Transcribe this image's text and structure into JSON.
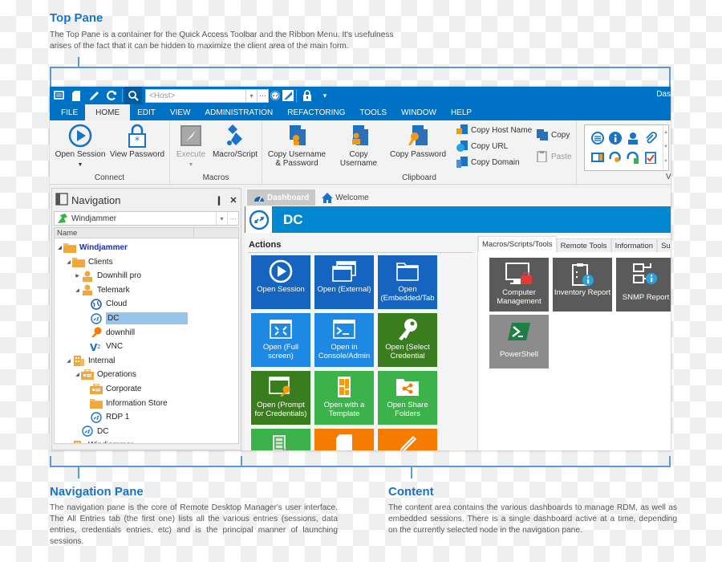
{
  "captions": {
    "top_pane": {
      "title": "Top Pane",
      "line1": "The Top Pane is a container for the Quick Access Toolbar and the Ribbon Menu. It's usefulness",
      "line2": "arises of the fact that it can be hidden to maximize the client area of the main form."
    },
    "navigation_pane": {
      "title": "Navigation Pane",
      "text": "The navigation pane is the core of Remote Desktop Manager's user interface. The All Entries tab (the first one) lists all the various entries (sessions, data entries, credentials entries, etc) and is the principal manner of launching sessions."
    },
    "content": {
      "title": "Content",
      "text": "The content area contains the various dashboards to manage RDM, as well as embedded sessions. There is a single dashboard active at a time, depending on the currently selected node in the navigation pane."
    }
  },
  "quick_access": {
    "icons": [
      "window-icon",
      "new-document-icon",
      "edit-pencil-icon",
      "refresh-icon",
      "search-icon"
    ],
    "host_placeholder": "<Host>",
    "more_label": "···",
    "title_fragment": "Das"
  },
  "menu_tabs": [
    {
      "label": "FILE",
      "active": false
    },
    {
      "label": "HOME",
      "active": true
    },
    {
      "label": "EDIT",
      "active": false
    },
    {
      "label": "VIEW",
      "active": false
    },
    {
      "label": "ADMINISTRATION",
      "active": false
    },
    {
      "label": "REFACTORING",
      "active": false
    },
    {
      "label": "TOOLS",
      "active": false
    },
    {
      "label": "WINDOW",
      "active": false
    },
    {
      "label": "HELP",
      "active": false
    }
  ],
  "ribbon": {
    "connect": {
      "label": "Connect",
      "open_session": "Open Session",
      "view_password": "View Password"
    },
    "macros": {
      "label": "Macros",
      "execute": "Execute",
      "macro_script": "Macro/Script"
    },
    "clipboard": {
      "label": "Clipboard",
      "copy_user_pass_1": "Copy Username",
      "copy_user_pass_2": "& Password",
      "copy_username": "Copy Username",
      "copy_password": "Copy Password",
      "copy_host_name": "Copy Host Name",
      "copy_url": "Copy URL",
      "copy_domain": "Copy Domain",
      "copy": "Copy",
      "paste": "Paste"
    },
    "view_group_label_fragment": "V"
  },
  "navigation": {
    "title": "Navigation",
    "pin_label": "❙",
    "close_label": "✕",
    "datasource": "Windjammer",
    "column_name": "Name",
    "tree": [
      {
        "label": "Windjammer",
        "expander": "◢",
        "icon": "folder",
        "bold": true,
        "level": 0
      },
      {
        "label": "Clients",
        "expander": "◢",
        "icon": "folder",
        "level": 1
      },
      {
        "label": "Downhill pro",
        "expander": "▶",
        "icon": "contact",
        "level": 2
      },
      {
        "label": "Telemark",
        "expander": "◢",
        "icon": "contact",
        "level": 2
      },
      {
        "label": "Cloud",
        "expander": "",
        "icon": "globe",
        "level": 3
      },
      {
        "label": "DC",
        "expander": "",
        "icon": "rdp",
        "level": 3,
        "selected": true
      },
      {
        "label": "downhill",
        "expander": "",
        "icon": "key",
        "level": 3
      },
      {
        "label": "VNC",
        "expander": "",
        "icon": "vnc",
        "level": 3
      },
      {
        "label": "Internal",
        "expander": "◢",
        "icon": "building",
        "level": 1
      },
      {
        "label": "Operations",
        "expander": "◢",
        "icon": "briefcase",
        "level": 2
      },
      {
        "label": "Corporate",
        "expander": "",
        "icon": "briefcase",
        "level": 3
      },
      {
        "label": "Information Store",
        "expander": "",
        "icon": "folder",
        "level": 3
      },
      {
        "label": "RDP 1",
        "expander": "",
        "icon": "rdp",
        "level": 3
      },
      {
        "label": "DC",
        "expander": "",
        "icon": "rdp",
        "level": 2
      },
      {
        "label": "Windjammer",
        "expander": "▶",
        "icon": "building",
        "level": 1
      }
    ]
  },
  "content": {
    "tabs": [
      {
        "label": "Dashboard",
        "icon": "dashboard-icon",
        "active": true
      },
      {
        "label": "Welcome",
        "icon": "home-icon",
        "active": false
      }
    ],
    "entry_title": "DC",
    "actions_title": "Actions",
    "actions": [
      {
        "label": "Open Session",
        "icon": "play-circle",
        "color": "#1565c0"
      },
      {
        "label": "Open (External)",
        "icon": "windows",
        "color": "#1565c0"
      },
      {
        "label": "Open (Embedded/Tab",
        "icon": "folder-tab",
        "color": "#1565c0"
      },
      {
        "label": "Open (Full screen)",
        "icon": "fullscreen",
        "color": "#1e88e5"
      },
      {
        "label": "Open in Console/Admin",
        "icon": "console",
        "color": "#1e88e5"
      },
      {
        "label": "Open (Select Credential",
        "icon": "key",
        "color": "#3a7d1e"
      },
      {
        "label": "Open (Prompt for Credentials)",
        "icon": "window-key",
        "color": "#3a7d1e"
      },
      {
        "label": "Open with a Template",
        "icon": "template",
        "color": "#3bb34a"
      },
      {
        "label": "Open Share Folders",
        "icon": "share-folder",
        "color": "#3bb34a"
      },
      {
        "label": "",
        "icon": "checklist",
        "color": "#3bb34a"
      },
      {
        "label": "",
        "icon": "document",
        "color": "#f57c00"
      },
      {
        "label": "",
        "icon": "pencil",
        "color": "#f57c00"
      }
    ],
    "side_tabs": [
      {
        "label": "Macros/Scripts/Tools",
        "active": true
      },
      {
        "label": "Remote Tools",
        "active": false
      },
      {
        "label": "Information",
        "active": false
      },
      {
        "label": "Su",
        "active": false
      }
    ],
    "tools": [
      {
        "label": "Computer Management",
        "icon": "computer-toolbox",
        "color": "#5a5a5a"
      },
      {
        "label": "Inventory Report",
        "icon": "clipboard-info",
        "color": "#5a5a5a"
      },
      {
        "label": "SNMP Report",
        "icon": "network-info",
        "color": "#5a5a5a"
      },
      {
        "label": "PowerShell",
        "icon": "powershell",
        "color": "#8c8c8c"
      }
    ]
  }
}
